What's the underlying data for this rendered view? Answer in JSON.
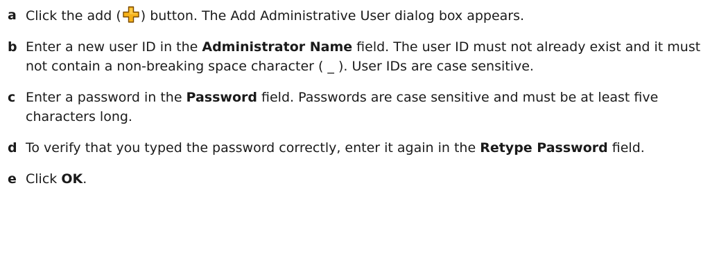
{
  "steps": [
    {
      "letter": "a",
      "parts": [
        "Click the add (",
        "icon:add-plus-icon",
        ") button. The Add Administrative User dialog box appears."
      ]
    },
    {
      "letter": "b",
      "parts": [
        "Enter a new user ID in the ",
        "b:Administrator Name",
        " field. The user ID must not already exist and it must not contain a non-breaking space character ( _ ). User IDs are case sensitive."
      ]
    },
    {
      "letter": "c",
      "parts": [
        "Enter a password in the ",
        "b:Password",
        " field. Passwords are case sensitive and must be at least five characters long."
      ]
    },
    {
      "letter": "d",
      "parts": [
        "To verify that you typed the password correctly, enter it again in the ",
        "b:Retype Password",
        " field."
      ]
    },
    {
      "letter": "e",
      "parts": [
        "Click ",
        "b:OK",
        "."
      ]
    }
  ],
  "colors": {
    "add_icon_fill": "#f6b21b",
    "add_icon_stroke": "#7a4a00"
  }
}
